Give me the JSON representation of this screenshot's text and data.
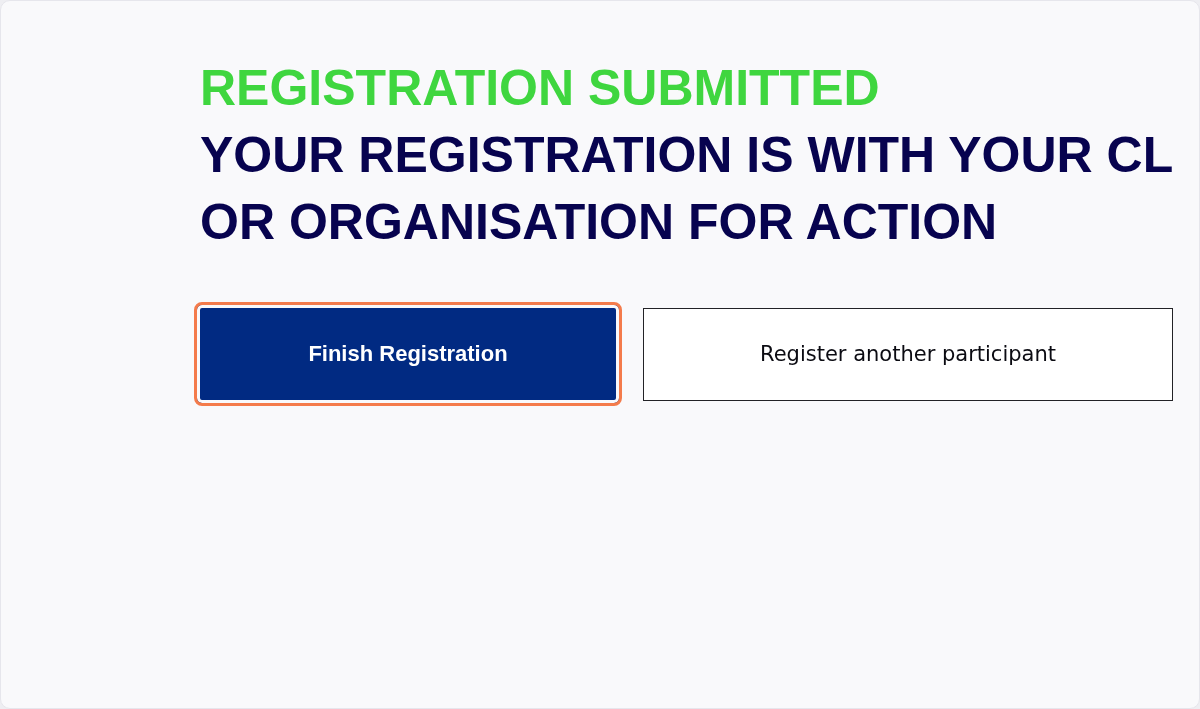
{
  "status": {
    "title": "REGISTRATION SUBMITTED"
  },
  "message": {
    "lines": [
      "YOUR REGISTRATION IS WITH YOUR CL",
      "OR ORGANISATION FOR ACTION"
    ]
  },
  "buttons": [
    {
      "label": "Finish Registration",
      "kind": "primary",
      "focused": true
    },
    {
      "label": "Register another participant",
      "kind": "secondary",
      "focused": false
    }
  ]
}
